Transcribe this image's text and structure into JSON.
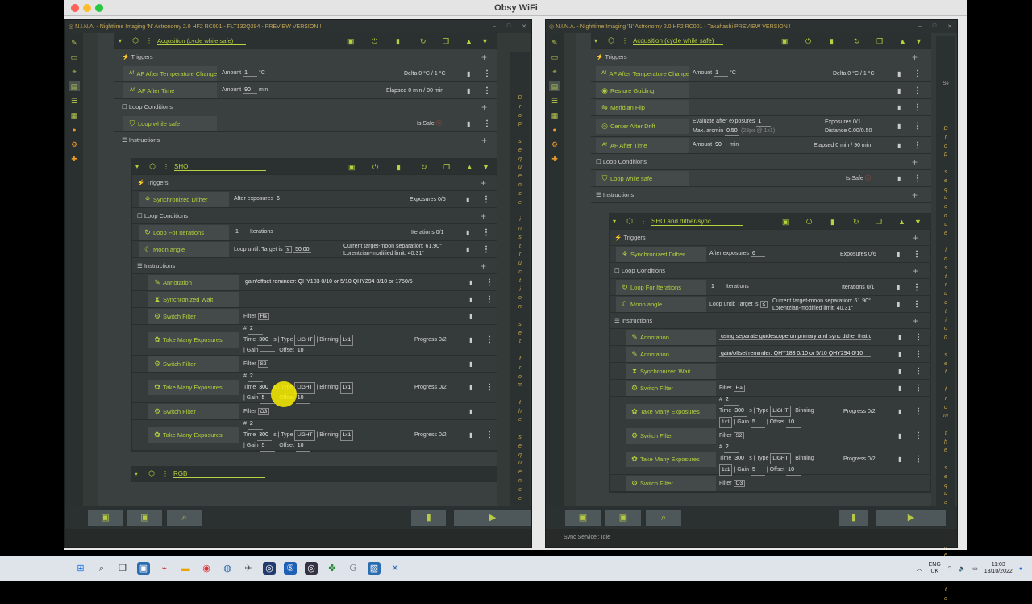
{
  "mac": {
    "title": "Obsy WiFi"
  },
  "left": {
    "title": "N.I.N.A. - Nighttime Imaging 'N' Astronomy 2.0 HF2 RC001 - FLT132Q294 - PREVIEW VERSION !",
    "seq_title": "Acqusition (cycle while safe)",
    "triggers_label": "Triggers",
    "loop_label": "Loop Conditions",
    "instr_label": "Instructions",
    "af_temp": {
      "name": "AF After Temperature Change",
      "amount_label": "Amount",
      "amount": "1",
      "unit": "°C",
      "delta": "Delta 0 °C / 1 °C"
    },
    "af_time": {
      "name": "AF After Time",
      "amount_label": "Amount",
      "amount": "90",
      "unit": "min",
      "elapsed": "Elapsed 0 min / 90 min"
    },
    "loop_safe": {
      "name": "Loop while safe",
      "status": "Is Safe"
    },
    "sho": {
      "title": "SHO",
      "dither": {
        "name": "Synchronized Dither",
        "label": "After exposures",
        "value": "6",
        "progress": "Exposures 0/6"
      },
      "loop_iter": {
        "name": "Loop For Iterations",
        "value": "1",
        "label": "Iterations",
        "progress": "Iterations 0/1"
      },
      "moon": {
        "name": "Moon angle",
        "label": "Loop until: Target is",
        "op": "≤",
        "value": "50.00",
        "info1": "Current target-moon separation: 61.90°",
        "info2": "Lorentzian-modified limit: 40.31°"
      },
      "annotation": {
        "name": "Annotation",
        "text": "gain/offset reminder: QHY183 0/10 or 5/10     QHY294 0/10 or 1750/5"
      },
      "wait": {
        "name": "Synchronized Wait"
      },
      "sf1": {
        "name": "Switch Filter",
        "label": "Filter",
        "value": "Ha"
      },
      "tme1": {
        "name": "Take Many Exposures",
        "count": "2",
        "time": "300",
        "type": "LIGHT",
        "binning": "1x1",
        "gain": "",
        "offset": "10",
        "progress": "Progress 0/2"
      },
      "sf2": {
        "name": "Switch Filter",
        "label": "Filter",
        "value": "S2"
      },
      "tme2": {
        "name": "Take Many Exposures",
        "count": "2",
        "time": "300",
        "type": "LIGHT",
        "binning": "1x1",
        "gain": "5",
        "offset": "10",
        "progress": "Progress 0/2"
      },
      "sf3": {
        "name": "Switch Filter",
        "label": "Filter",
        "value": "O3"
      },
      "tme3": {
        "name": "Take Many Exposures",
        "count": "2",
        "time": "300",
        "type": "LIGHT",
        "binning": "1x1",
        "gain": "5",
        "offset": "10",
        "progress": "Progress 0/2"
      }
    },
    "rgb": {
      "title": "RGB"
    },
    "drop": "D\nr\no\np\n \ns\ne\nq\nu\ne\nn\nc\ne\n \ni\nn\ns\nt\nr\nu\nc\nt\ni\no\nn\n \ns\ne\nt\n \nf\nr\no\nm\n \nt\nh\ne\n \ns\ne\nq\nu\ne\nn\nc\ne\n \nh\ne\nr\ne\n \nt\no"
  },
  "right": {
    "title": "N.I.N.A. - Nighttime Imaging 'N' Astronomy 2.0 HF2 RC001 - Takahashi PREVIEW VERSION !",
    "seq_title": "Acqusition (cycle while safe)",
    "triggers_label": "Triggers",
    "loop_label": "Loop Conditions",
    "instr_label": "Instructions",
    "af_temp": {
      "name": "AF After Temperature Change",
      "amount_label": "Amount",
      "amount": "1",
      "unit": "°C",
      "delta": "Delta 0 °C / 1 °C"
    },
    "restore": {
      "name": "Restore Guiding"
    },
    "flip": {
      "name": "Meridian Flip"
    },
    "center": {
      "name": "Center After Drift",
      "l1": "Evaluate after exposures",
      "v1": "1",
      "l2": "Max. arcmin",
      "v2": "0.50",
      "hint": "(28px @ 1x1)",
      "r1": "Exposures 0/1",
      "r2": "Distance 0.00/0.50"
    },
    "af_time": {
      "name": "AF After Time",
      "amount_label": "Amount",
      "amount": "90",
      "unit": "min",
      "elapsed": "Elapsed 0 min / 90 min"
    },
    "loop_safe": {
      "name": "Loop while safe",
      "status": "Is Safe"
    },
    "sho": {
      "title": "SHO and dither/sync",
      "dither": {
        "name": "Synchronized Dither",
        "label": "After exposures",
        "value": "6",
        "progress": "Exposures 0/6"
      },
      "loop_iter": {
        "name": "Loop For Iterations",
        "value": "1",
        "label": "Iterations",
        "progress": "Iterations 0/1"
      },
      "moon": {
        "name": "Moon angle",
        "label": "Loop until: Target is",
        "op": "≤",
        "info1": "Current target-moon separation: 61.90°",
        "info2": "Lorentzian-modified limit: 40.31°"
      },
      "ann1": {
        "name": "Annotation",
        "text": "using separate guidescope on primary and sync dither that c"
      },
      "ann2": {
        "name": "Annotation",
        "text": "gain/offset reminder: QHY183 0/10 or 5/10     QHY294 0/10"
      },
      "wait": {
        "name": "Synchronized Wait"
      },
      "sf1": {
        "name": "Switch Filter",
        "label": "Filter",
        "value": "Ha"
      },
      "tme1": {
        "name": "Take Many Exposures",
        "count": "2",
        "time": "300",
        "type": "LIGHT",
        "binning": "1x1",
        "gain": "5",
        "offset": "10",
        "progress": "Progress 0/2"
      },
      "sf2": {
        "name": "Switch Filter",
        "label": "Filter",
        "value": "S2"
      },
      "tme2": {
        "name": "Take Many Exposures",
        "count": "2",
        "time": "300",
        "type": "LIGHT",
        "binning": "1x1",
        "gain": "5",
        "offset": "10",
        "progress": "Progress 0/2"
      },
      "sf3": {
        "name": "Switch Filter",
        "label": "Filter",
        "value": "O3"
      }
    },
    "status": "Sync Service :   Idle",
    "drop": "D\nr\no\np\n \ns\ne\nq\nu\ne\nn\nc\ne\n \ni\nn\ns\nt\nr\nu\nc\nt\ni\no\nn\n \ns\ne\nt\n \nf\nr\no\nm\n \nt\nh\ne\n \ns\ne\nq\nu\ne\nn\nc\ne\n \nh\ne\nr\ne\n \nt\no"
  },
  "labels": {
    "time": "Time",
    "type": "| Type",
    "binning": "| Binning",
    "gain": "| Gain",
    "offset": "| Offset",
    "hash": "#",
    "s": "s",
    "side": "Se"
  },
  "taskbar": {
    "lang1": "ENG",
    "lang2": "UK",
    "time": "11:03",
    "date": "13/10/2022"
  }
}
